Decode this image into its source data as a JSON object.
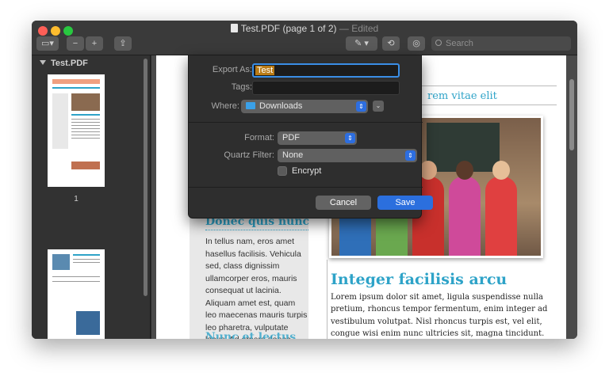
{
  "window": {
    "title": "Test.PDF (page 1 of 2)",
    "edited": "— Edited"
  },
  "toolbar": {
    "sidebar_toggle_icon": "sidebar-icon",
    "zoom_out_icon": "zoom-out-icon",
    "zoom_in_icon": "zoom-in-icon",
    "share_icon": "share-icon",
    "markup_icon": "pen-icon",
    "rotate_icon": "rotate-icon",
    "annotate_icon": "markup-circle-icon",
    "search_placeholder": "Search"
  },
  "sidebar": {
    "heading": "Test.PDF",
    "page_label": "1"
  },
  "sheet": {
    "export_label": "Export As:",
    "export_value": "Test",
    "tags_label": "Tags:",
    "tags_value": "",
    "where_label": "Where:",
    "where_value": "Downloads",
    "format_label": "Format:",
    "format_value": "PDF",
    "quartz_label": "Quartz Filter:",
    "quartz_value": "None",
    "encrypt_label": "Encrypt",
    "encrypt_checked": false,
    "cancel_label": "Cancel",
    "save_label": "Save"
  },
  "document": {
    "left_heading": "Donec quis nunc",
    "left_body": "In tellus nam, eros amet hasellus facilisis. Vehicula sed, class dignissim ullamcorper eros, mauris consequat ut lacinia. Aliquam amet est, quam leo maecenas mauris turpis leo pharetra, vulputate lacus. Ad ornare donec, fringilla feugiat augue.",
    "left_heading_2": "Nunc et lectus",
    "right_top_heading": "rem vitae elit",
    "right_title": "Integer facilisis arcu",
    "right_body": "Lorem ipsum dolor sit amet, ligula suspendisse nulla pretium, rhoncus tempor fermentum, enim integer ad vestibulum volutpat. Nisl rhoncus turpis est, vel elit, congue wisi enim nunc ultricies sit, magna tincidunt. Maecenas aliquam maecenas ligula nostra, accumsan taciti. Sociis mauris in integer, a dolor netus non dui aliquet, sagittis felis sodales, dolor sociis mauris, vel eu libero cras. Faucibus at. Arcu"
  }
}
